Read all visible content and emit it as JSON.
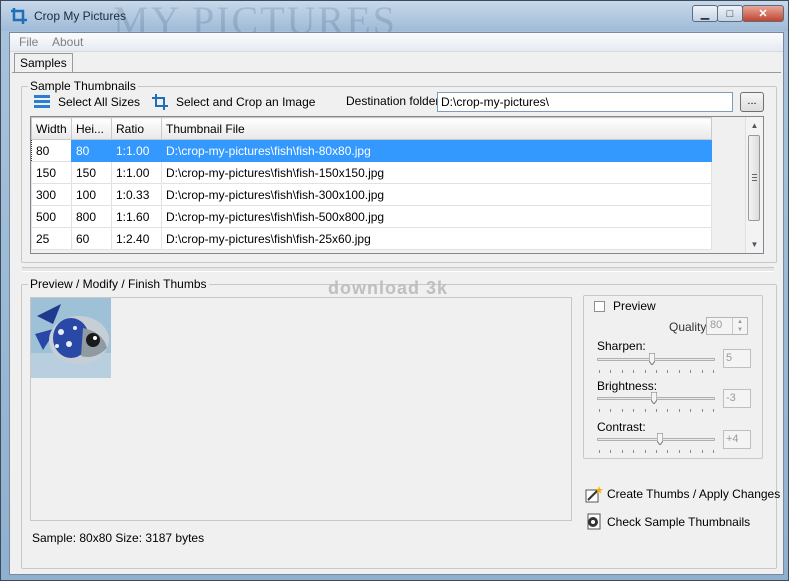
{
  "window": {
    "title": "Crop My Pictures",
    "title_watermark": "MY PICTURES",
    "controls": {
      "minimize": "▁",
      "maximize": "□",
      "close": "✕"
    }
  },
  "menu": {
    "items": [
      "File",
      "About"
    ]
  },
  "tabs": [
    {
      "label": "Samples",
      "active": true
    }
  ],
  "sample_thumbnails": {
    "group_label": "Sample Thumbnails",
    "select_all_label": "Select All Sizes",
    "select_crop_label": "Select and Crop an Image",
    "destination_label": "Destination folder:",
    "destination_value": "D:\\crop-my-pictures\\",
    "browse_label": "...",
    "columns": [
      "Width",
      "Hei...",
      "Ratio",
      "Thumbnail File"
    ],
    "rows": [
      {
        "width": "80",
        "height": "80",
        "ratio": "1:1.00",
        "file": "D:\\crop-my-pictures\\fish\\fish-80x80.jpg",
        "selected": true
      },
      {
        "width": "150",
        "height": "150",
        "ratio": "1:1.00",
        "file": "D:\\crop-my-pictures\\fish\\fish-150x150.jpg",
        "selected": false
      },
      {
        "width": "300",
        "height": "100",
        "ratio": "1:0.33",
        "file": "D:\\crop-my-pictures\\fish\\fish-300x100.jpg",
        "selected": false
      },
      {
        "width": "500",
        "height": "800",
        "ratio": "1:1.60",
        "file": "D:\\crop-my-pictures\\fish\\fish-500x800.jpg",
        "selected": false
      },
      {
        "width": "25",
        "height": "60",
        "ratio": "1:2.40",
        "file": "D:\\crop-my-pictures\\fish\\fish-25x60.jpg",
        "selected": false
      }
    ]
  },
  "preview_section": {
    "group_label": "Preview / Modify / Finish Thumbs",
    "watermark": "download 3k",
    "status": "Sample: 80x80 Size: 3187 bytes"
  },
  "options": {
    "preview_label": "Preview",
    "preview_checked": false,
    "quality_label": "Quality:",
    "quality_value": "80",
    "sharpen_label": "Sharpen:",
    "sharpen_value": "5",
    "sharpen_level": 0.47,
    "brightness_label": "Brightness:",
    "brightness_value": "-3",
    "brightness_level": 0.48,
    "contrast_label": "Contrast:",
    "contrast_value": "+4",
    "contrast_level": 0.53
  },
  "actions": {
    "create_label": "Create Thumbs / Apply Changes",
    "check_label": "Check Sample Thumbnails"
  },
  "colors": {
    "selection": "#3399ff",
    "title_gradient_top": "#c7d9ea",
    "client_bg": "#f0f0f0"
  }
}
